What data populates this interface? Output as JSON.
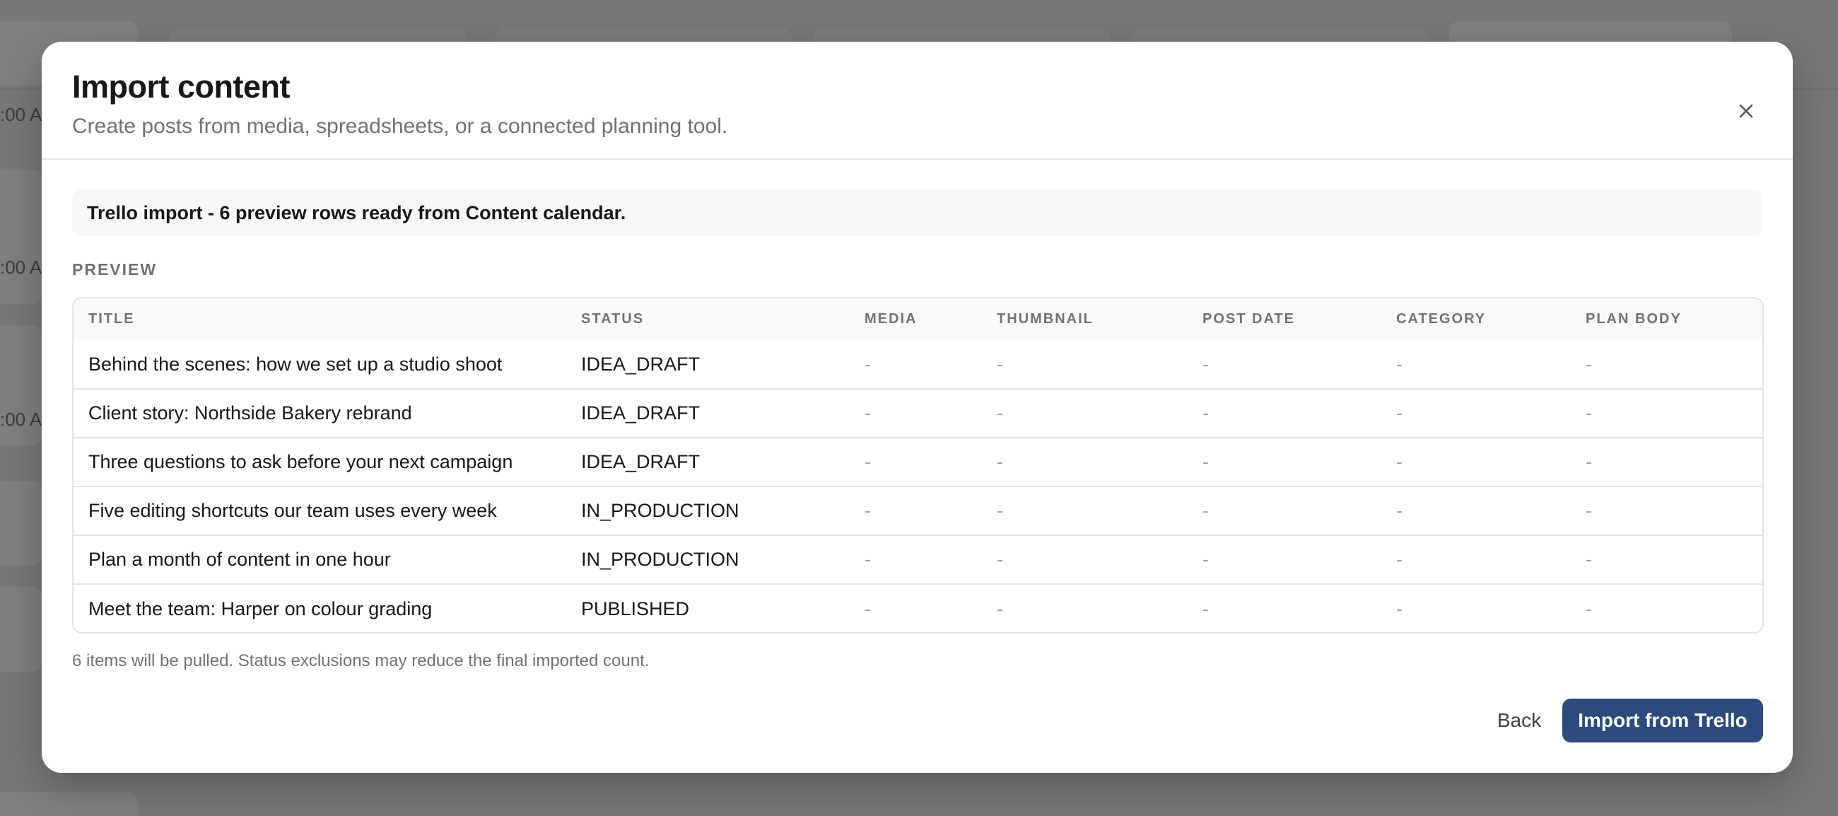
{
  "background": {
    "times": [
      ":00 A",
      ":00 A",
      ":00 A"
    ]
  },
  "modal": {
    "title": "Import content",
    "subtitle": "Create posts from media, spreadsheets, or a connected planning tool.",
    "close_icon": "close-icon",
    "notice": "Trello import - 6 preview rows ready from Content calendar.",
    "preview_label": "PREVIEW",
    "table": {
      "columns": [
        "TITLE",
        "STATUS",
        "MEDIA",
        "THUMBNAIL",
        "POST DATE",
        "CATEGORY",
        "PLAN BODY"
      ],
      "rows": [
        {
          "title": "Behind the scenes: how we set up a studio shoot",
          "status": "IDEA_DRAFT",
          "media": "-",
          "thumbnail": "-",
          "post_date": "-",
          "category": "-",
          "plan_body": "-"
        },
        {
          "title": "Client story: Northside Bakery rebrand",
          "status": "IDEA_DRAFT",
          "media": "-",
          "thumbnail": "-",
          "post_date": "-",
          "category": "-",
          "plan_body": "-"
        },
        {
          "title": "Three questions to ask before your next campaign",
          "status": "IDEA_DRAFT",
          "media": "-",
          "thumbnail": "-",
          "post_date": "-",
          "category": "-",
          "plan_body": "-"
        },
        {
          "title": "Five editing shortcuts our team uses every week",
          "status": "IN_PRODUCTION",
          "media": "-",
          "thumbnail": "-",
          "post_date": "-",
          "category": "-",
          "plan_body": "-"
        },
        {
          "title": "Plan a month of content in one hour",
          "status": "IN_PRODUCTION",
          "media": "-",
          "thumbnail": "-",
          "post_date": "-",
          "category": "-",
          "plan_body": "-"
        },
        {
          "title": "Meet the team: Harper on colour grading",
          "status": "PUBLISHED",
          "media": "-",
          "thumbnail": "-",
          "post_date": "-",
          "category": "-",
          "plan_body": "-"
        }
      ]
    },
    "footnote": "6 items will be pulled. Status exclusions may reduce the final imported count.",
    "back_label": "Back",
    "primary_label": "Import from Trello",
    "colors": {
      "primary": "#2c4a7c",
      "overlay": "#77787a"
    }
  }
}
